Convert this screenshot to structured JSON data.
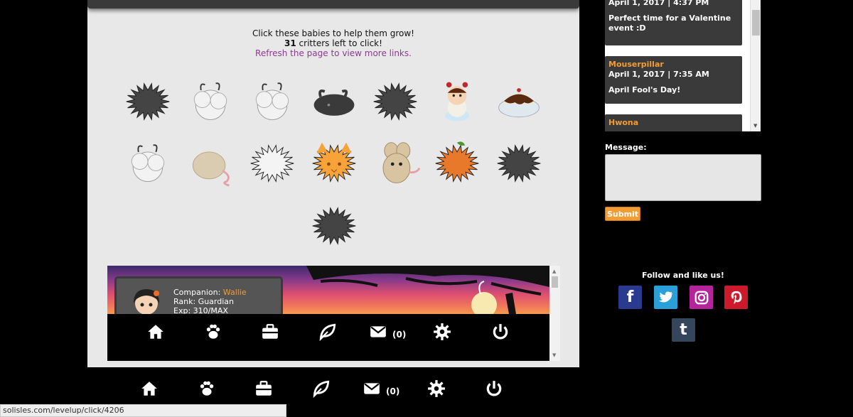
{
  "intro": {
    "line1": "Click these babies to help them grow!",
    "count": "31",
    "line2_suffix": " critters left to click!",
    "refresh": "Refresh the page to view more links."
  },
  "critters": [
    {
      "name": "black-spiky-critter",
      "color": "#444444"
    },
    {
      "name": "white-fluffy-critter",
      "color": "#f2f2f2"
    },
    {
      "name": "white-fluffy-critter",
      "color": "#f2f2f2"
    },
    {
      "name": "black-horned-critter",
      "color": "#3a3a3a"
    },
    {
      "name": "black-spiky-critter",
      "color": "#444444"
    },
    {
      "name": "ladybug-doll-critter",
      "color": "#f6d3b4"
    },
    {
      "name": "chocolate-sundae-critter",
      "color": "#5a2a10"
    },
    {
      "name": "white-fluffy-critter",
      "color": "#f2f2f2"
    },
    {
      "name": "tan-mouse-critter",
      "color": "#d9ccb0"
    },
    {
      "name": "white-spiky-critter",
      "color": "#f4f4f4"
    },
    {
      "name": "orange-cat-critter",
      "color": "#f7a33a"
    },
    {
      "name": "tan-bunny-critter",
      "color": "#d8c4a0"
    },
    {
      "name": "orange-leaf-critter",
      "color": "#e9792a"
    },
    {
      "name": "black-spiky-critter",
      "color": "#444444"
    },
    {
      "name": "black-spiky-critter",
      "color": "#444444"
    }
  ],
  "companion": {
    "companion_label": "Companion: ",
    "companion_name": "Wallie",
    "rank": "Rank: Guardian",
    "exp": "Exp: 310/MAX"
  },
  "nav": {
    "mail_count": "(0)"
  },
  "shoutbox": {
    "entries": [
      {
        "who": "",
        "date": "April 1, 2017 | 4:37 PM",
        "text": "Perfect time for a Valentine event :D"
      },
      {
        "who": "Mouserpillar",
        "date": "April 1, 2017 | 7:35 AM",
        "text": "April Fool's Day!"
      },
      {
        "who": "Hwona",
        "date": "",
        "text": ""
      }
    ]
  },
  "message": {
    "label": "Message:",
    "submit": "Submit"
  },
  "follow": {
    "label": "Follow and like us!"
  },
  "social": {
    "facebook_glyph": "f",
    "tumblr_glyph": "t"
  },
  "status_url": "solisles.com/levelup/click/4206",
  "colors": {
    "accent": "#f39c33",
    "refresh_link": "#8a3b8f",
    "facebook": "#2a3b8f",
    "twitter": "#2a9fd8",
    "instagram": "#b4249b",
    "pinterest": "#cc1a2a",
    "tumblr": "#35465c"
  }
}
